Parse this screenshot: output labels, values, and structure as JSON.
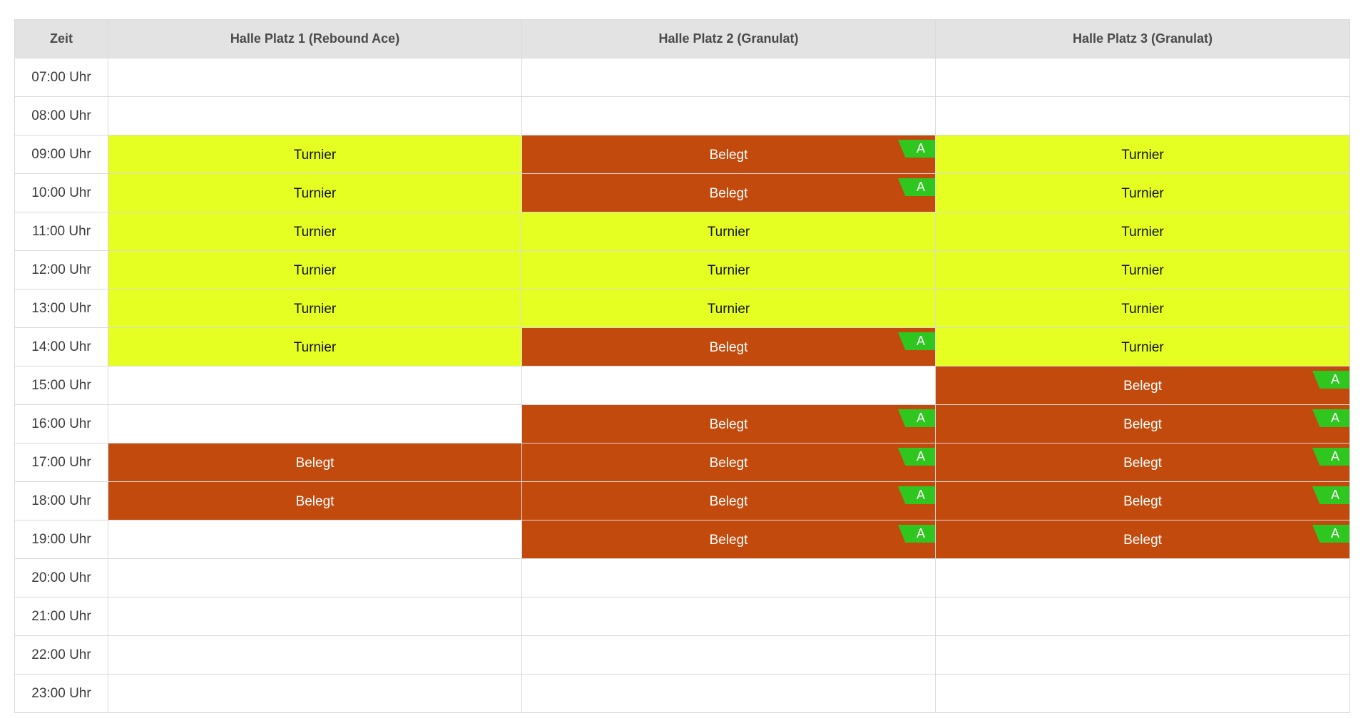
{
  "colors": {
    "turnier": "#e5ff22",
    "belegt": "#c14a0c",
    "badge": "#2fc71f",
    "header_bg": "#e3e3e3",
    "border": "#dadada"
  },
  "header": {
    "time": "Zeit",
    "courts": [
      "Halle Platz 1 (Rebound Ace)",
      "Halle Platz 2 (Granulat)",
      "Halle Platz 3 (Granulat)"
    ]
  },
  "rows": [
    {
      "time": "07:00 Uhr",
      "slots": [
        {
          "status": "empty",
          "label": ""
        },
        {
          "status": "empty",
          "label": ""
        },
        {
          "status": "empty",
          "label": ""
        }
      ]
    },
    {
      "time": "08:00 Uhr",
      "slots": [
        {
          "status": "empty",
          "label": ""
        },
        {
          "status": "empty",
          "label": ""
        },
        {
          "status": "empty",
          "label": ""
        }
      ]
    },
    {
      "time": "09:00 Uhr",
      "slots": [
        {
          "status": "turnier",
          "label": "Turnier"
        },
        {
          "status": "belegt",
          "label": "Belegt",
          "badge": "A"
        },
        {
          "status": "turnier",
          "label": "Turnier"
        }
      ]
    },
    {
      "time": "10:00 Uhr",
      "slots": [
        {
          "status": "turnier",
          "label": "Turnier"
        },
        {
          "status": "belegt",
          "label": "Belegt",
          "badge": "A"
        },
        {
          "status": "turnier",
          "label": "Turnier"
        }
      ]
    },
    {
      "time": "11:00 Uhr",
      "slots": [
        {
          "status": "turnier",
          "label": "Turnier"
        },
        {
          "status": "turnier",
          "label": "Turnier"
        },
        {
          "status": "turnier",
          "label": "Turnier"
        }
      ]
    },
    {
      "time": "12:00 Uhr",
      "slots": [
        {
          "status": "turnier",
          "label": "Turnier"
        },
        {
          "status": "turnier",
          "label": "Turnier"
        },
        {
          "status": "turnier",
          "label": "Turnier"
        }
      ]
    },
    {
      "time": "13:00 Uhr",
      "slots": [
        {
          "status": "turnier",
          "label": "Turnier"
        },
        {
          "status": "turnier",
          "label": "Turnier"
        },
        {
          "status": "turnier",
          "label": "Turnier"
        }
      ]
    },
    {
      "time": "14:00 Uhr",
      "slots": [
        {
          "status": "turnier",
          "label": "Turnier"
        },
        {
          "status": "belegt",
          "label": "Belegt",
          "badge": "A"
        },
        {
          "status": "turnier",
          "label": "Turnier"
        }
      ]
    },
    {
      "time": "15:00 Uhr",
      "slots": [
        {
          "status": "empty",
          "label": ""
        },
        {
          "status": "empty",
          "label": ""
        },
        {
          "status": "belegt",
          "label": "Belegt",
          "badge": "A"
        }
      ]
    },
    {
      "time": "16:00 Uhr",
      "slots": [
        {
          "status": "empty",
          "label": ""
        },
        {
          "status": "belegt",
          "label": "Belegt",
          "badge": "A"
        },
        {
          "status": "belegt",
          "label": "Belegt",
          "badge": "A"
        }
      ]
    },
    {
      "time": "17:00 Uhr",
      "slots": [
        {
          "status": "belegt",
          "label": "Belegt"
        },
        {
          "status": "belegt",
          "label": "Belegt",
          "badge": "A"
        },
        {
          "status": "belegt",
          "label": "Belegt",
          "badge": "A"
        }
      ]
    },
    {
      "time": "18:00 Uhr",
      "slots": [
        {
          "status": "belegt",
          "label": "Belegt"
        },
        {
          "status": "belegt",
          "label": "Belegt",
          "badge": "A"
        },
        {
          "status": "belegt",
          "label": "Belegt",
          "badge": "A"
        }
      ]
    },
    {
      "time": "19:00 Uhr",
      "slots": [
        {
          "status": "empty",
          "label": ""
        },
        {
          "status": "belegt",
          "label": "Belegt",
          "badge": "A"
        },
        {
          "status": "belegt",
          "label": "Belegt",
          "badge": "A"
        }
      ]
    },
    {
      "time": "20:00 Uhr",
      "slots": [
        {
          "status": "empty",
          "label": ""
        },
        {
          "status": "empty",
          "label": ""
        },
        {
          "status": "empty",
          "label": ""
        }
      ]
    },
    {
      "time": "21:00 Uhr",
      "slots": [
        {
          "status": "empty",
          "label": ""
        },
        {
          "status": "empty",
          "label": ""
        },
        {
          "status": "empty",
          "label": ""
        }
      ]
    },
    {
      "time": "22:00 Uhr",
      "slots": [
        {
          "status": "empty",
          "label": ""
        },
        {
          "status": "empty",
          "label": ""
        },
        {
          "status": "empty",
          "label": ""
        }
      ]
    },
    {
      "time": "23:00 Uhr",
      "slots": [
        {
          "status": "empty",
          "label": ""
        },
        {
          "status": "empty",
          "label": ""
        },
        {
          "status": "empty",
          "label": ""
        }
      ]
    }
  ]
}
